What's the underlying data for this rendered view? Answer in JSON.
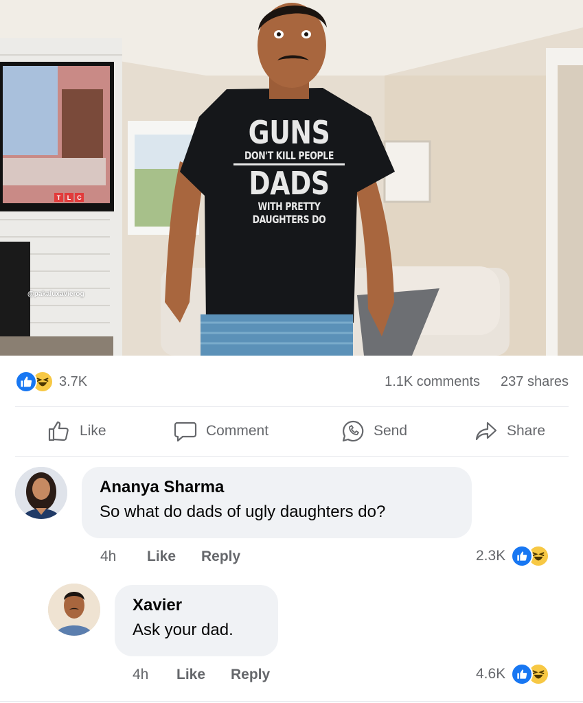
{
  "post": {
    "watermark": "@pakaluxavierog",
    "tv_logo": [
      "T",
      "L",
      "C"
    ],
    "shirt": {
      "line1": "GUNS",
      "line2": "DON'T KILL PEOPLE",
      "line3": "DADS",
      "line4": "WITH PRETTY",
      "line5": "DAUGHTERS DO"
    },
    "reactions": {
      "icons": [
        "like-icon",
        "haha-icon"
      ],
      "count": "3.7K"
    },
    "comments_count": "1.1K comments",
    "shares_count": "237 shares"
  },
  "actions": {
    "like": "Like",
    "comment": "Comment",
    "send": "Send",
    "share": "Share"
  },
  "comments": [
    {
      "author": "Ananya Sharma",
      "text": "So what do dads of ugly daughters do?",
      "time": "4h",
      "like_label": "Like",
      "reply_label": "Reply",
      "reaction_count": "2.3K"
    },
    {
      "author": "Xavier",
      "text": "Ask your dad.",
      "time": "4h",
      "like_label": "Like",
      "reply_label": "Reply",
      "reaction_count": "4.6K"
    }
  ],
  "colors": {
    "accent": "#1877f2",
    "haha": "#f7c844",
    "muted": "#65676b",
    "bubble": "#f0f2f5"
  }
}
